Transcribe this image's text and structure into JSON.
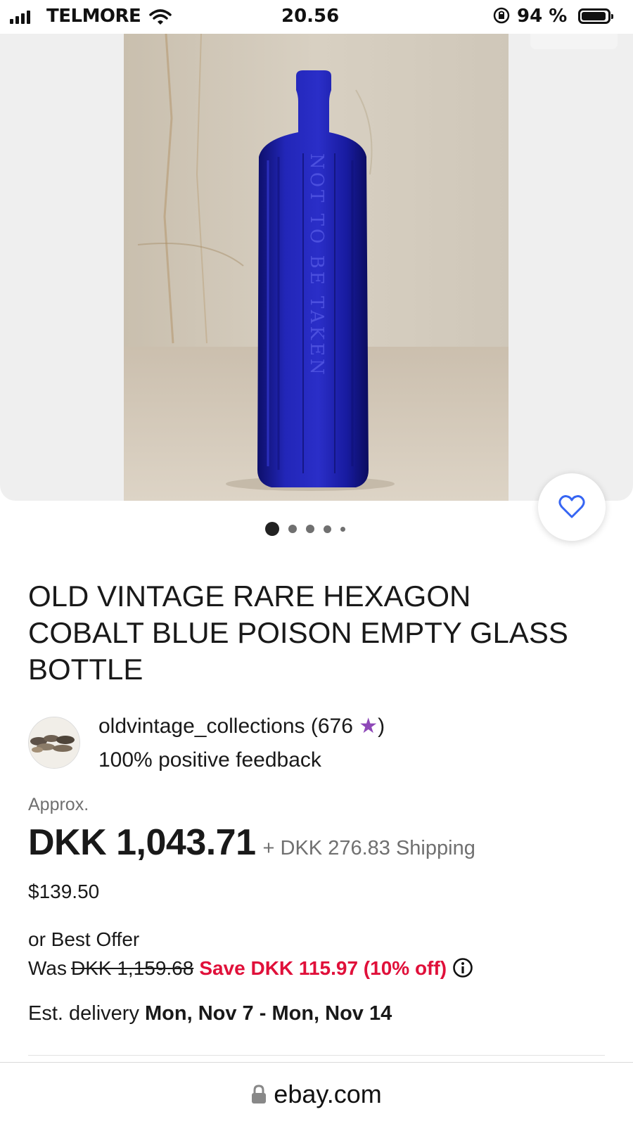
{
  "status_bar": {
    "carrier": "TELMORE",
    "time": "20.56",
    "battery_percent": "94 %",
    "signal_bars": 4,
    "icons": [
      "signal-icon",
      "wifi-icon",
      "rotation-lock-icon",
      "battery-icon"
    ]
  },
  "gallery": {
    "image_count": 5,
    "active_index": 0,
    "image_text": "NOT TO BE TAKEN"
  },
  "listing": {
    "title": "OLD VINTAGE RARE HEXAGON COBALT BLUE POISON EMPTY GLASS BOTTLE",
    "seller": {
      "name_line": "oldvintage_collections (676 ",
      "star": "★",
      "close_paren": ")",
      "feedback": "100% positive feedback"
    },
    "approx_label": "Approx.",
    "price": "DKK 1,043.71",
    "shipping": "+ DKK 276.83 Shipping",
    "usd_price": "$139.50",
    "best_offer": "or Best Offer",
    "was_label": "Was",
    "was_price": "DKK 1,159.68",
    "save_text": "Save DKK 115.97 (10% off)",
    "delivery_label": "Est. delivery ",
    "delivery_dates": "Mon, Nov 7 - Mon, Nov 14"
  },
  "browser": {
    "url": "ebay.com"
  },
  "colors": {
    "save_red": "#e0103a",
    "star_purple": "#8e48b8",
    "heart_blue": "#3665f3",
    "bottle_blue": "#1c1fa8"
  }
}
